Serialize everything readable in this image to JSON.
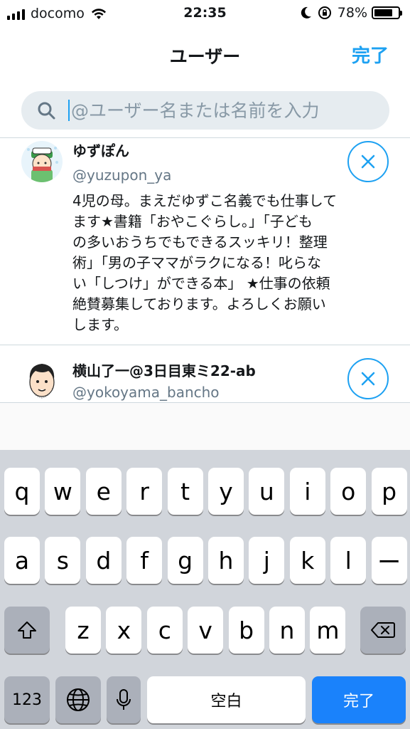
{
  "status_bar": {
    "carrier": "docomo",
    "time": "22:35",
    "battery_percent": "78%",
    "battery_level": 0.78
  },
  "nav": {
    "title": "ユーザー",
    "done_label": "完了"
  },
  "search": {
    "placeholder": "@ユーザー名または名前を入力",
    "value": ""
  },
  "users": [
    {
      "name": "ゆずぽん",
      "handle": "@yuzupon_ya",
      "bio": "4児の母。まえだゆずこ名義でも仕事して\nます★書籍「おやこぐらし。」「子ども\nの多いおうちでもできるスッキリ！整理\n術」「男の子ママがラクになる！叱らな\nい「しつけ」ができる本」 ★仕事の依頼\n絶賛募集しております。よろしくお願い\nします。"
    },
    {
      "name": "横山了一@3日目東ミ22-ab",
      "handle": "@yokoyama_bancho",
      "bio": ""
    }
  ],
  "keyboard": {
    "row1": [
      "q",
      "w",
      "e",
      "r",
      "t",
      "y",
      "u",
      "i",
      "o",
      "p"
    ],
    "row2": [
      "a",
      "s",
      "d",
      "f",
      "g",
      "h",
      "j",
      "k",
      "l",
      "ー"
    ],
    "row3": [
      "z",
      "x",
      "c",
      "v",
      "b",
      "n",
      "m"
    ],
    "numbers_label": "123",
    "space_label": "空白",
    "done_label": "完了"
  },
  "colors": {
    "accent": "#1da1f2",
    "keyboard_bg": "#d1d5db",
    "done_key": "#1a82fb"
  }
}
